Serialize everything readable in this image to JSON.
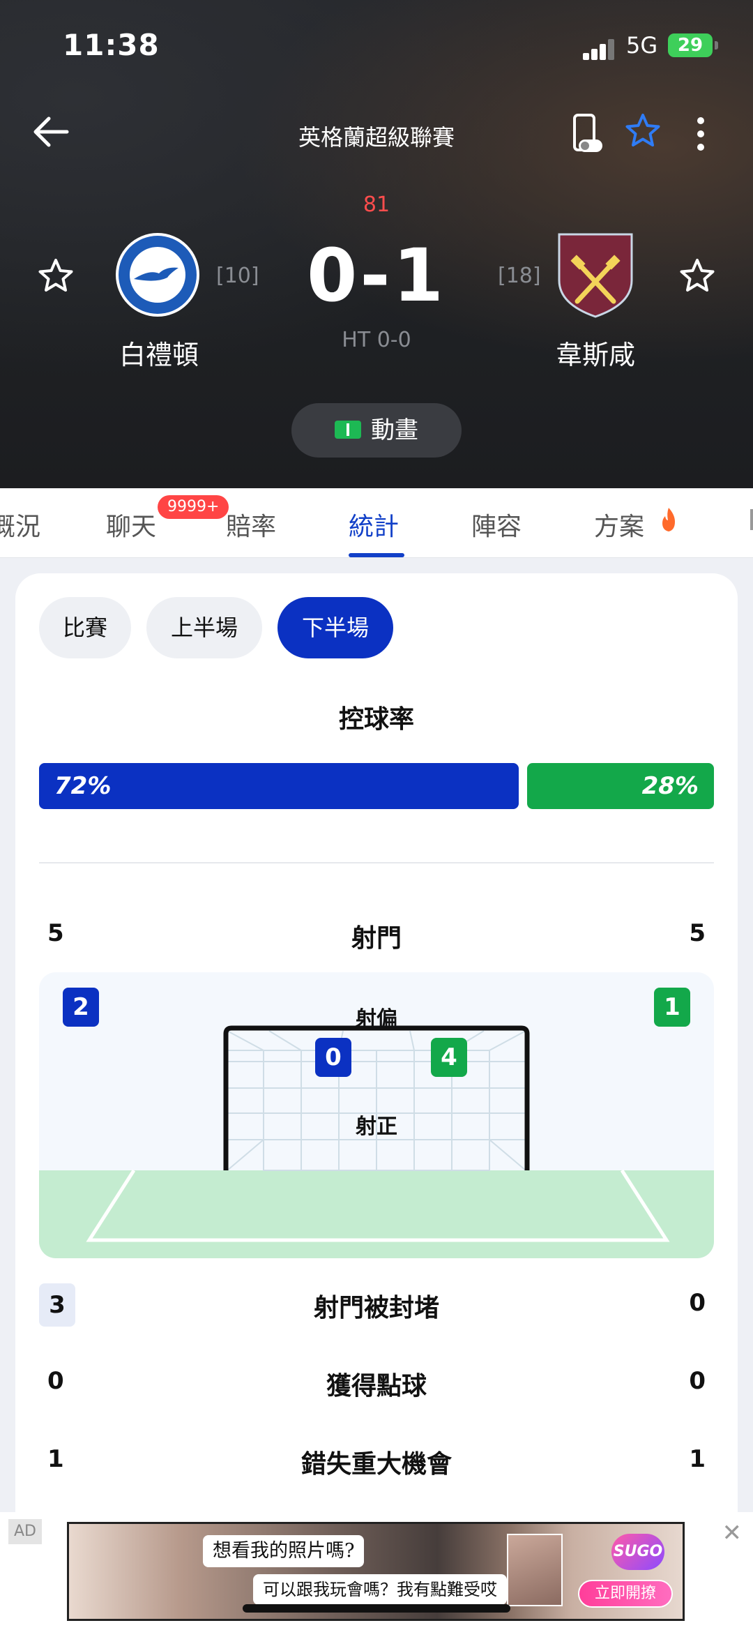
{
  "status_bar": {
    "time": "11:38",
    "network": "5G",
    "battery": "29"
  },
  "header": {
    "league": "英格蘭超級聯賽"
  },
  "match": {
    "minute": "81",
    "score": "0-1",
    "halftime": "HT 0-0",
    "home": {
      "name": "白禮頓",
      "rank": "[10]"
    },
    "away": {
      "name": "韋斯咸",
      "rank": "[18]"
    },
    "animation_label": "動畫"
  },
  "tabs": [
    {
      "label": "概況"
    },
    {
      "label": "聊天"
    },
    {
      "label": "賠率"
    },
    {
      "label": "統計"
    },
    {
      "label": "陣容"
    },
    {
      "label": "方案"
    }
  ],
  "chat_badge": "9999+",
  "period_chips": [
    "比賽",
    "上半場",
    "下半場"
  ],
  "active_chip": "下半場",
  "possession": {
    "title": "控球率",
    "home": "72%",
    "away": "28%",
    "home_fraction": 0.72
  },
  "stats": {
    "shots": {
      "label": "射門",
      "home": "5",
      "away": "5"
    },
    "shots_off": {
      "label": "射偏",
      "home": "2",
      "away": "1"
    },
    "shots_on": {
      "label": "射正",
      "home": "0",
      "away": "4"
    },
    "blocked": {
      "label": "射門被封堵",
      "home": "3",
      "away": "0"
    },
    "penalties": {
      "label": "獲得點球",
      "home": "0",
      "away": "0"
    },
    "big_chances_missed": {
      "label": "錯失重大機會",
      "home": "1",
      "away": "1"
    }
  },
  "colors": {
    "home": "#0b31c2",
    "away": "#13a84a",
    "accent": "#1240c8"
  },
  "ad": {
    "tag": "AD",
    "line1": "想看我的照片嗎?",
    "line2": "可以跟我玩會嗎？我有點難受哎",
    "brand": "SUGO",
    "cta": "立即開撩"
  }
}
